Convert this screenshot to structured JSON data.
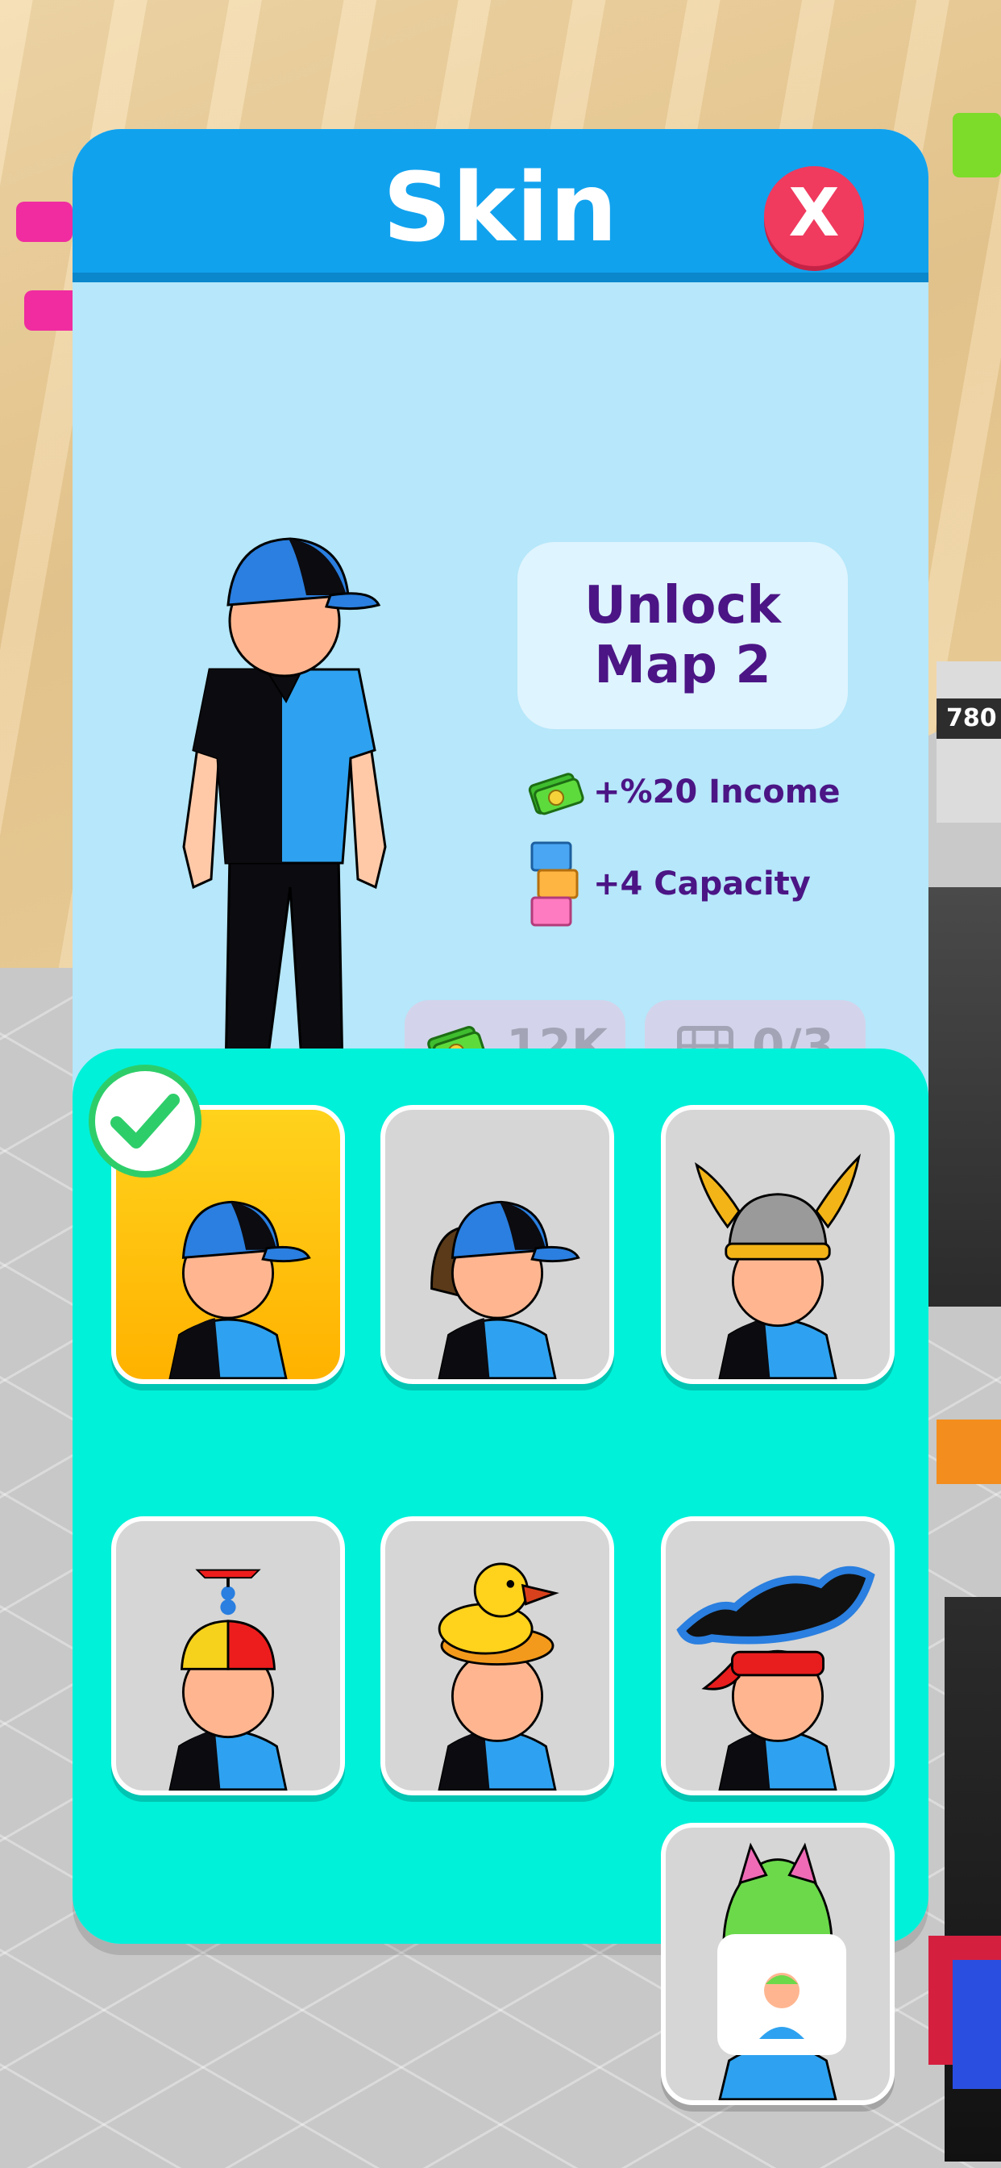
{
  "background": {
    "price_tag": "780"
  },
  "panel": {
    "title": "Skin",
    "close_label": "X",
    "unlock_text": "Unlock Map 2",
    "perks": [
      {
        "icon": "cash-icon",
        "label": "+%20 Income"
      },
      {
        "icon": "stacked-boxes-icon",
        "label": "+4 Capacity"
      }
    ],
    "cost_buttons": [
      {
        "icon": "cash-icon",
        "label": "12K"
      },
      {
        "icon": "video-icon",
        "label": "0/3"
      }
    ]
  },
  "skins": [
    {
      "name": "blue-cap",
      "selected": true,
      "locked": false
    },
    {
      "name": "ponytail-cap",
      "selected": false,
      "locked": false
    },
    {
      "name": "viking-helmet",
      "selected": false,
      "locked": false
    },
    {
      "name": "propeller-beanie",
      "selected": false,
      "locked": false
    },
    {
      "name": "duck-hat",
      "selected": false,
      "locked": false
    },
    {
      "name": "pirate-hat",
      "selected": false,
      "locked": false
    },
    {
      "name": "monster-hood",
      "selected": false,
      "locked": true
    }
  ],
  "colors": {
    "header": "#11a2ee",
    "panel_bg": "#b6e7fa",
    "grid_bg": "#00f1d9",
    "close": "#f03a5e",
    "text_purple": "#4b1585",
    "selected_card": "#ffc20e",
    "disabled_button": "#d3d4eb"
  }
}
